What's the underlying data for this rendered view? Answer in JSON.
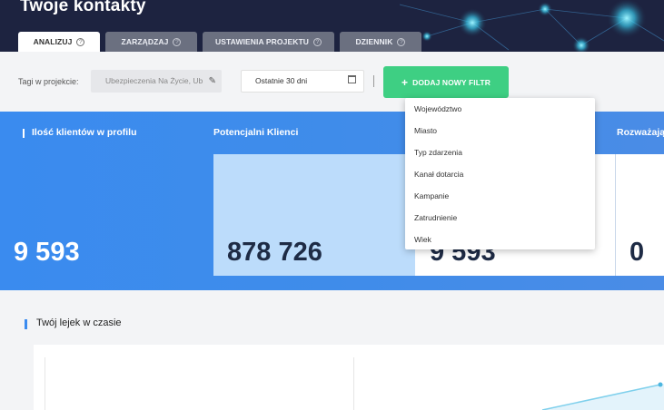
{
  "header": {
    "title": "Twoje kontakty",
    "tabs": [
      {
        "label": "ANALIZUJ",
        "active": true
      },
      {
        "label": "ZARZĄDZAJ",
        "active": false
      },
      {
        "label": "USTAWIENIA PROJEKTU",
        "active": false
      },
      {
        "label": "DZIENNIK",
        "active": false
      }
    ]
  },
  "toolbar": {
    "tags_label": "Tagi w projekcie:",
    "tags_value": "Ubezpieczenia Na Życie, Ub",
    "date_value": "Ostatnie 30 dni",
    "add_filter_label": "DODAJ NOWY FILTR"
  },
  "filter_menu": {
    "items": [
      "Województwo",
      "Miasto",
      "Typ zdarzenia",
      "Kanał dotarcia",
      "Kampanie",
      "Zatrudnienie",
      "Wiek"
    ]
  },
  "stats": [
    {
      "title": "Ilość klientów w profilu",
      "value": "9 593"
    },
    {
      "title": "Potencjalni Klienci",
      "value": "878 726"
    },
    {
      "title": "",
      "value": "9 593"
    },
    {
      "title": "Rozważają",
      "value": "0"
    }
  ],
  "funnel": {
    "title": "Twój lejek w czasie"
  },
  "colors": {
    "header_bg": "#1d2340",
    "stats_blue": "#3a8bef",
    "accent_green": "#3ecf83",
    "light_blue_box": "#bcdcfb"
  }
}
